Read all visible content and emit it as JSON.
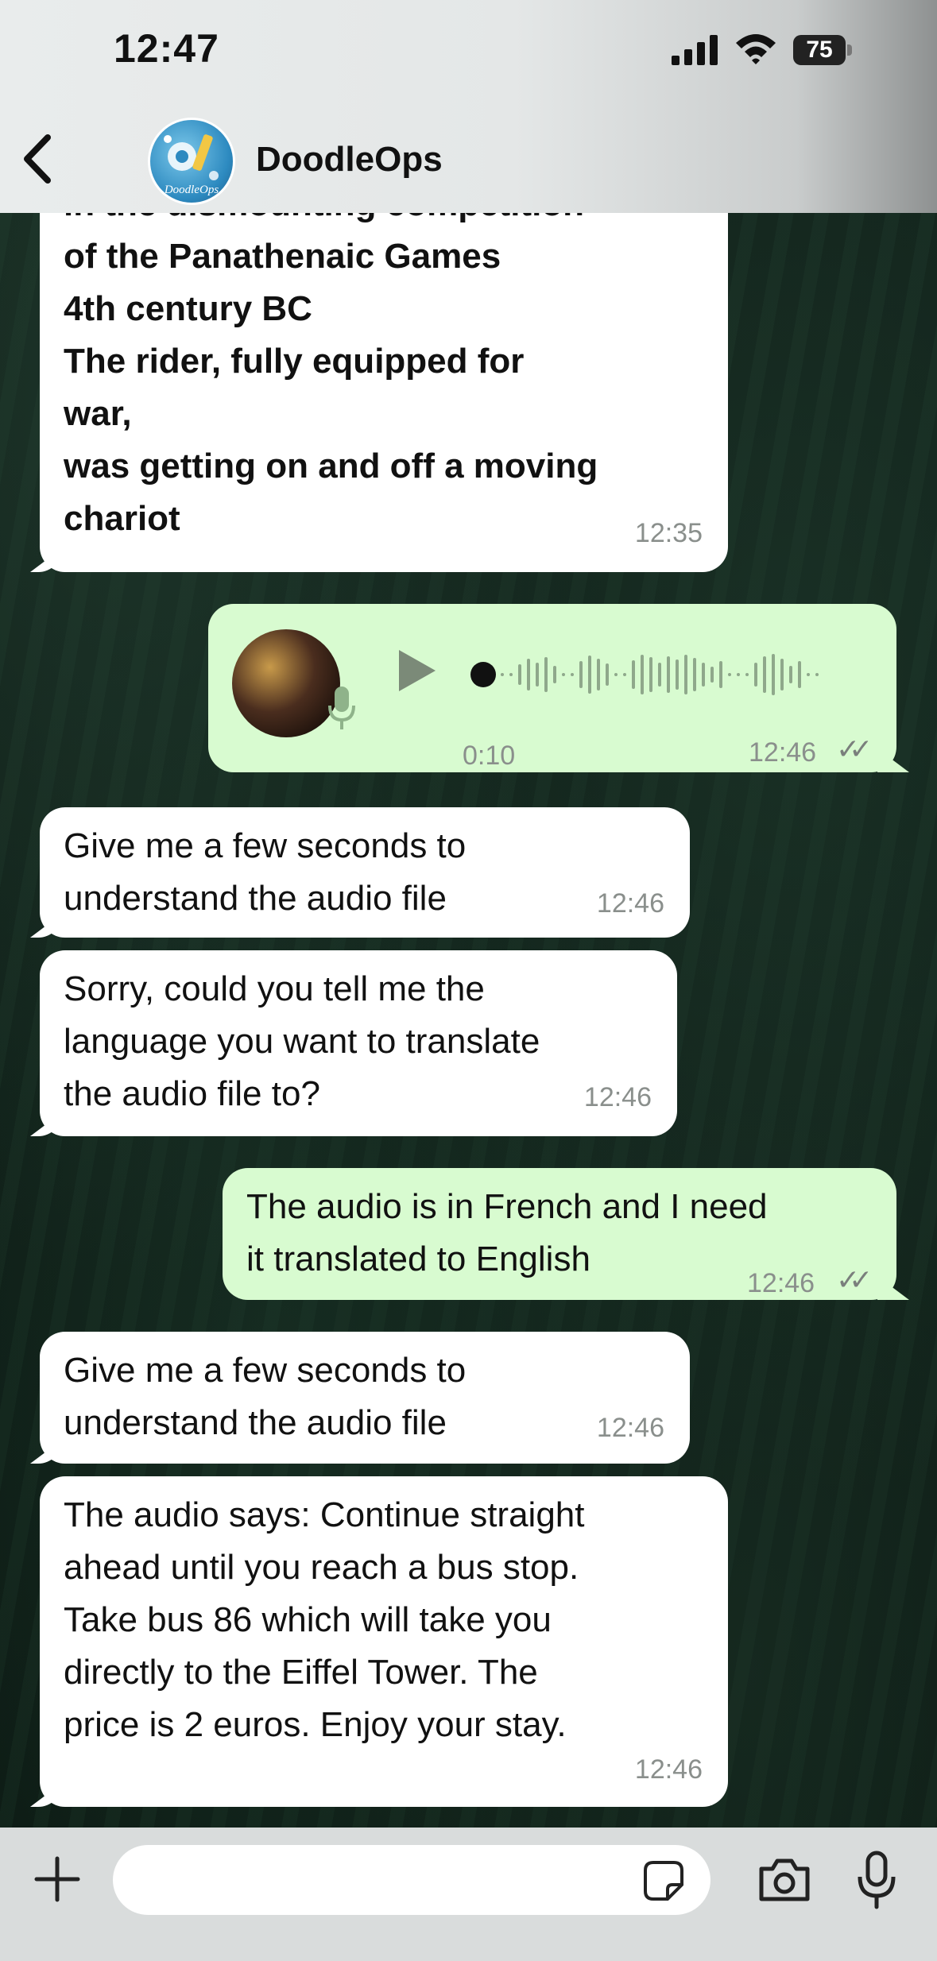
{
  "status_bar": {
    "time": "12:47",
    "battery": "75"
  },
  "header": {
    "contact_name": "DoodleOps",
    "avatar_text": "DoodleOps"
  },
  "messages": [
    {
      "direction": "incoming",
      "lines": "in the dismounting competition\nof the Panathenaic Games\n4th century BC\nThe rider, fully equipped for\nwar,\nwas getting on and off a moving\nchariot",
      "time": "12:35"
    },
    {
      "direction": "outgoing",
      "type": "voice",
      "duration": "0:10",
      "time": "12:46",
      "ticks": "✓✓"
    },
    {
      "direction": "incoming",
      "lines": "Give me a few seconds to\nunderstand the audio file",
      "time": "12:46"
    },
    {
      "direction": "incoming",
      "lines": "Sorry, could you tell me the\nlanguage you want to translate\nthe audio file to?",
      "time": "12:46"
    },
    {
      "direction": "outgoing",
      "lines": "The audio is in French and I need\nit translated to English",
      "time": "12:46",
      "ticks": "✓✓"
    },
    {
      "direction": "incoming",
      "lines": "Give me a few seconds to\nunderstand the audio file",
      "time": "12:46"
    },
    {
      "direction": "incoming",
      "lines": "The audio says: Continue straight\nahead until you reach a bus stop.\nTake bus 86 which will take you\ndirectly to the Eiffel Tower. The\nprice is 2 euros. Enjoy your stay.",
      "time": "12:46"
    }
  ],
  "composer": {
    "input_value": "",
    "input_placeholder": ""
  },
  "icons": {
    "back": "chevron-left-icon",
    "plus": "plus-icon",
    "sticker": "sticker-icon",
    "camera": "camera-icon",
    "mic": "microphone-icon",
    "play": "play-icon"
  },
  "colors": {
    "incoming_bubble": "#ffffff",
    "outgoing_bubble": "#d8fbd0",
    "timestamp": "#8a8f8c"
  }
}
